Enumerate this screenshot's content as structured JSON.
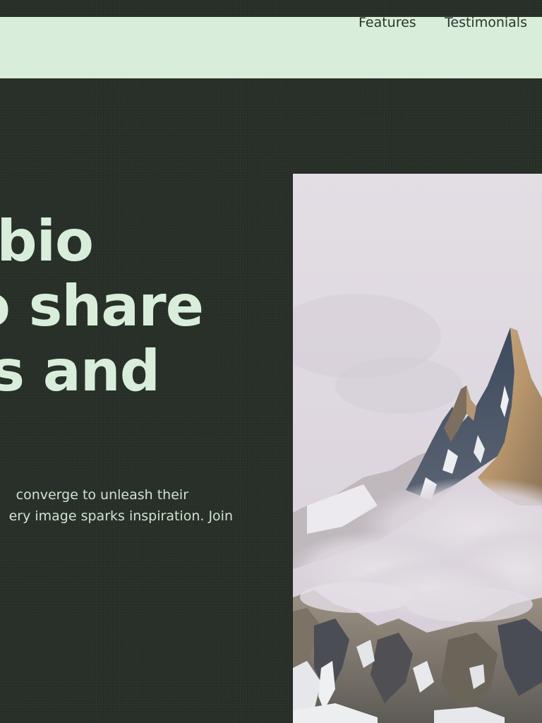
{
  "nav": {
    "links": [
      {
        "label": "Features"
      },
      {
        "label": "Testimonials"
      }
    ]
  },
  "hero": {
    "title_lines": [
      "bio",
      "o share",
      "s and"
    ],
    "description_lines": [
      "converge to unleash their",
      "ery image sparks inspiration. Join"
    ],
    "image": {
      "subject": "snowy mountain peak in clouds"
    }
  },
  "colors": {
    "background": "#272f27",
    "navbar": "#d8eedb",
    "heading": "#d8eedb",
    "body_text": "#cfe3d1",
    "nav_text": "#2b342b"
  }
}
